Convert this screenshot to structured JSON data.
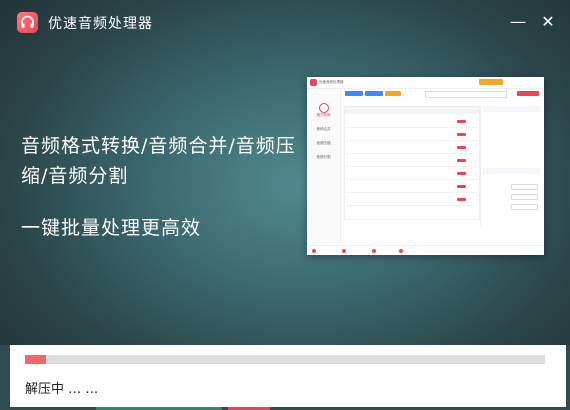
{
  "window": {
    "title": "优速音频处理器",
    "minimize_symbol": "—",
    "close_symbol": "✕"
  },
  "promo": {
    "headline": "音频格式转换/音频合并/音频压缩/音频分割",
    "subline": "一键批量处理更高效"
  },
  "progress": {
    "fraction": 0.04,
    "fill_color": "#f06868",
    "status_text": "解压中 … …"
  },
  "icons": [
    "headphones-icon",
    "minimize-icon",
    "close-icon"
  ],
  "colors": {
    "accent": "#e8455a",
    "background": "#3b6a70"
  }
}
